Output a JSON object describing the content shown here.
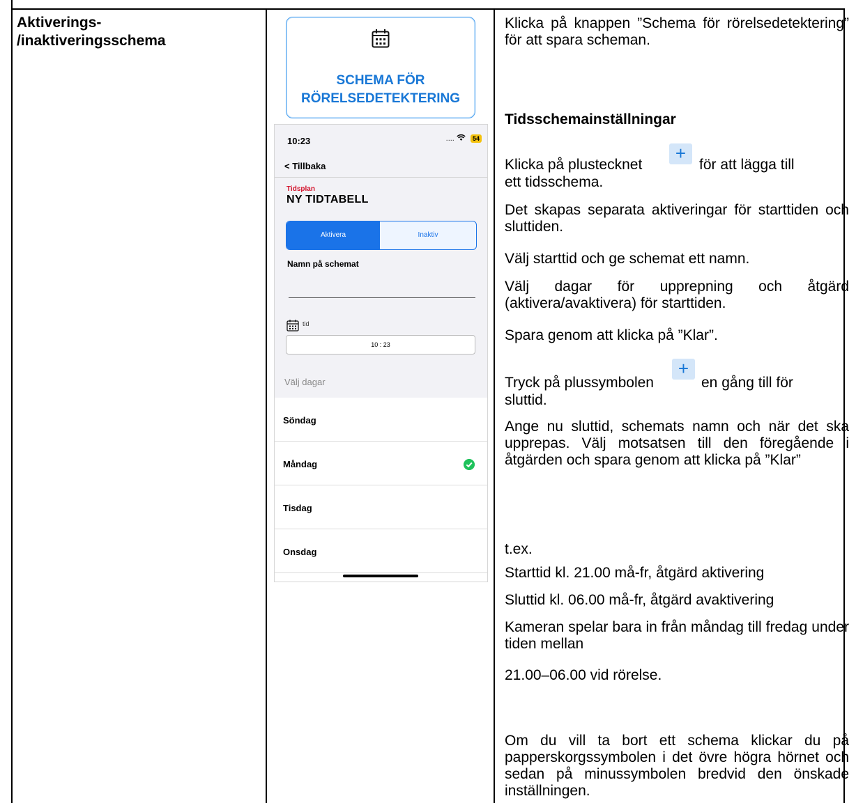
{
  "left_column": {
    "label_line1": "Aktiverings-",
    "label_line2": "/inaktiveringsschema"
  },
  "banner": {
    "icon": "calendar-icon",
    "line1": "SCHEMA FÖR",
    "line2": "RÖRELSEDETEKTERING",
    "accent": "#1877d6"
  },
  "phone": {
    "status_time": "10:23",
    "status_signal": ".... ",
    "battery": "54",
    "back_label": "Tillbaka",
    "schedule_small": "Tidsplan",
    "schedule_title": "NY TIDTABELL",
    "segment": {
      "active": "Aktivera",
      "inactive": "Inaktiv"
    },
    "name_label": "Namn på schemat",
    "name_value": "",
    "tid_label": "tid",
    "time_value": "10 : 23",
    "days_header": "Välj dagar",
    "days": [
      {
        "label": "Söndag",
        "checked": false
      },
      {
        "label": "Måndag",
        "checked": true
      },
      {
        "label": "Tisdag",
        "checked": false
      },
      {
        "label": "Onsdag",
        "checked": false
      }
    ]
  },
  "instructions": {
    "p1": "Klicka på knappen ”Schema för rörelsedetektering” för att spara scheman.",
    "heading": "Tidsschemainställningar",
    "p2_before": "Klicka på plustecknet",
    "p2_after": "för att lägga till",
    "p2_line2": "ett tidsschema.",
    "p3": "Det skapas separata aktiveringar för starttiden och sluttiden.",
    "p4": "Välj starttid och ge schemat ett namn.",
    "p5": "Välj dagar för upprepning och åtgärd (aktivera/avaktivera) för starttiden.",
    "p6": "Spara genom att klicka på ”Klar”.",
    "p7_before": "Tryck på plussymbolen",
    "p7_after": "en gång till för",
    "p7_line2": "sluttid.",
    "p8": "Ange nu sluttid, schemats namn och när det ska upprepas. Välj motsatsen till den föregående i åtgärden och spara genom att klicka på ”Klar”",
    "example_label": "t.ex.",
    "ex1": "Starttid kl. 21.00 må-fr, åtgärd aktivering",
    "ex2": "Sluttid kl. 06.00 må-fr, åtgärd avaktivering",
    "ex3": "Kameran spelar bara in från måndag till fredag under tiden mellan",
    "ex4": "21.00–06.00 vid rörelse.",
    "p9": "Om du vill ta bort ett schema klickar du på papperskorgssymbolen i det övre högra hörnet och sedan på minussymbolen bredvid den önskade inställningen.",
    "plus_symbol": "+"
  }
}
